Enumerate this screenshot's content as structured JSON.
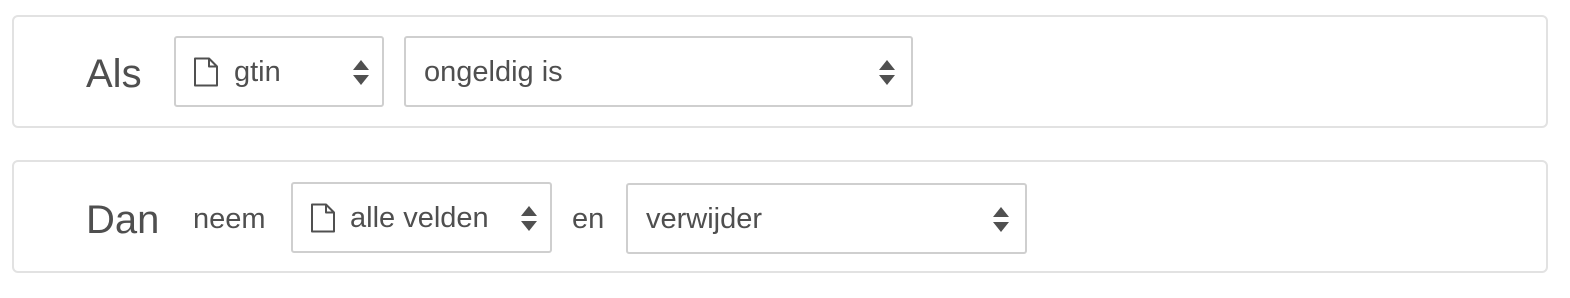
{
  "if_row": {
    "label": "Als",
    "field_select": {
      "value": "gtin",
      "icon": "document-icon"
    },
    "condition_select": {
      "value": "ongeldig is"
    }
  },
  "then_row": {
    "label": "Dan",
    "take_text": "neem",
    "field_select": {
      "value": "alle velden",
      "icon": "document-icon"
    },
    "connector_text": "en",
    "action_select": {
      "value": "verwijder"
    }
  },
  "colors": {
    "panel_border": "#e2e2e2",
    "select_border": "#cfcfcf",
    "text": "#4f4f4f",
    "arrow": "#505050"
  }
}
